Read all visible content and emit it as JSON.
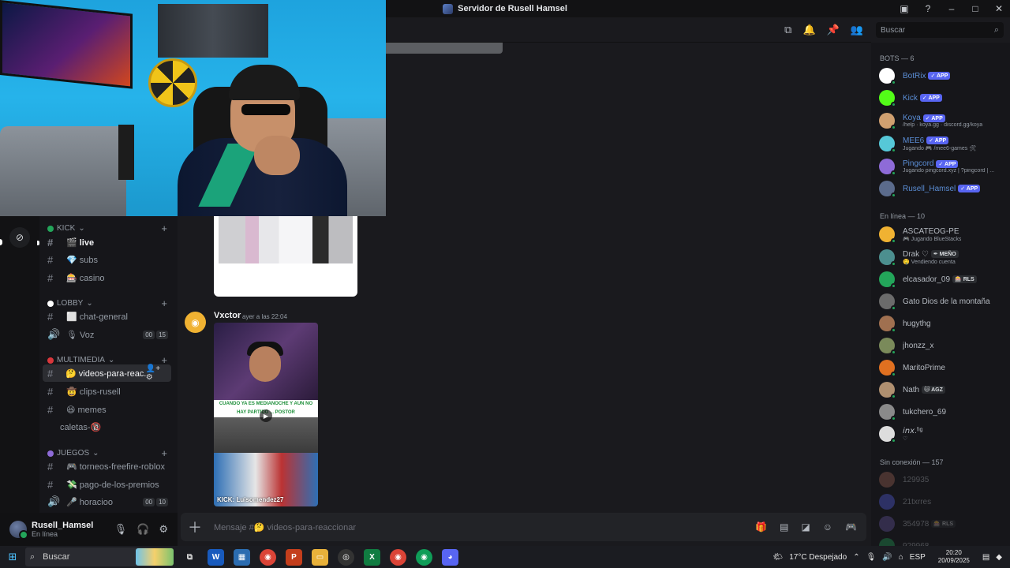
{
  "window": {
    "title": "Servidor de Rusell Hamsel"
  },
  "search": {
    "placeholder": "Buscar"
  },
  "sidebar": {
    "categories": [
      {
        "label": "KICK",
        "color": "#23a55a"
      },
      {
        "label": "LOBBY",
        "color": "#ffffff"
      },
      {
        "label": "MULTIMEDIA",
        "color": "#da373c"
      },
      {
        "label": "JUEGOS",
        "color": "#8e6bd8"
      }
    ],
    "channels": [
      {
        "label": "🎬 live",
        "type": "text"
      },
      {
        "label": "💎 subs",
        "type": "text"
      },
      {
        "label": "🎰 casino",
        "type": "text"
      },
      {
        "label": "⬜ chat-general",
        "type": "text"
      },
      {
        "label": "🎙 Voz",
        "type": "voice",
        "c1": "00",
        "c2": "15"
      },
      {
        "label": "🤔 videos-para-reac...",
        "type": "text"
      },
      {
        "label": "🤠 clips-rusell",
        "type": "text"
      },
      {
        "label": "😆 memes",
        "type": "text"
      },
      {
        "label": "caletas-🔞",
        "type": "text"
      },
      {
        "label": "🎮 torneos-freefire-roblox",
        "type": "text"
      },
      {
        "label": "💸 pago-de-los-premios",
        "type": "text"
      },
      {
        "label": "🎤 horacioo",
        "type": "voice",
        "c1": "00",
        "c2": "10"
      }
    ]
  },
  "user": {
    "name": "Rusell_Hamsel",
    "status": "En línea"
  },
  "message": {
    "author": "Vxctor",
    "time": "ayer a las 22:04",
    "clip_caption": "CUANDO YA ES MEDIANOCHE Y AUN NO HAY PARTIDO ... POSTOR",
    "clip_watermark": "KICK: Luisomendez27"
  },
  "composer": {
    "placeholder": "Mensaje #🤔 videos-para-reaccionar"
  },
  "members": {
    "bots_header": "BOTS — 6",
    "online_header": "En línea — 10",
    "offline_header": "Sin conexión — 157",
    "app_label": "✓ APP",
    "bots": [
      {
        "name": "BotRix",
        "sub": "",
        "color": "#ffffff"
      },
      {
        "name": "Kick",
        "sub": "",
        "color": "#53fc18"
      },
      {
        "name": "Koya",
        "sub": "/help · koya.gg · discord.gg/koya",
        "color": "#d0a070"
      },
      {
        "name": "MEE6",
        "sub": "Jugando 🎮 /mee6-games 🛠",
        "color": "#56c8d8"
      },
      {
        "name": "Pingcord",
        "sub": "Jugando pingcord.xyz | ?pingcord | ...",
        "color": "#8e6bd8"
      },
      {
        "name": "Rusell_Hamsel",
        "sub": "",
        "color": "#5b6b8c"
      }
    ],
    "online": [
      {
        "name": "ASCATEOG-PE",
        "sub": "🎮 Jugando BlueStacks",
        "tag": "",
        "color": "#f0b232"
      },
      {
        "name": "Drak ♡",
        "sub": "🤤 Vendiendo cuenta",
        "tag": "✒ MEÑO",
        "color": "#4c8f8f"
      },
      {
        "name": "elcasador_09",
        "sub": "",
        "tag": "🎰 RLS",
        "color": "#23a55a"
      },
      {
        "name": "Gato Dios de la montaña",
        "sub": "",
        "tag": "",
        "color": "#6b6b6b"
      },
      {
        "name": "hugythg",
        "sub": "",
        "tag": "",
        "color": "#a07050"
      },
      {
        "name": "jhonzz_x",
        "sub": "",
        "tag": "",
        "color": "#7a8a5a"
      },
      {
        "name": "MaritoPrime",
        "sub": "",
        "tag": "",
        "color": "#e07020"
      },
      {
        "name": "Nath",
        "sub": "",
        "tag": "🐱 AGZ",
        "color": "#b09070"
      },
      {
        "name": "tukchero_69",
        "sub": "",
        "tag": "",
        "color": "#8a8a8a"
      },
      {
        "name": "𝘪𝘯𝘹.ᶠᶦᵍ",
        "sub": "♡",
        "tag": "",
        "color": "#dddddd"
      }
    ],
    "offline": [
      {
        "name": "129935",
        "tag": "",
        "color": "#a86a5a"
      },
      {
        "name": "21txrres",
        "tag": "",
        "color": "#5865f2"
      },
      {
        "name": "354978",
        "tag": "🎰 RLS",
        "color": "#6b5aa8"
      },
      {
        "name": "929968",
        "tag": "",
        "color": "#23a55a"
      }
    ]
  },
  "taskbar": {
    "search": "Buscar",
    "weather": "17°C  Despejado",
    "lang": "ESP",
    "time": "20:20",
    "date": "20/09/2025"
  }
}
